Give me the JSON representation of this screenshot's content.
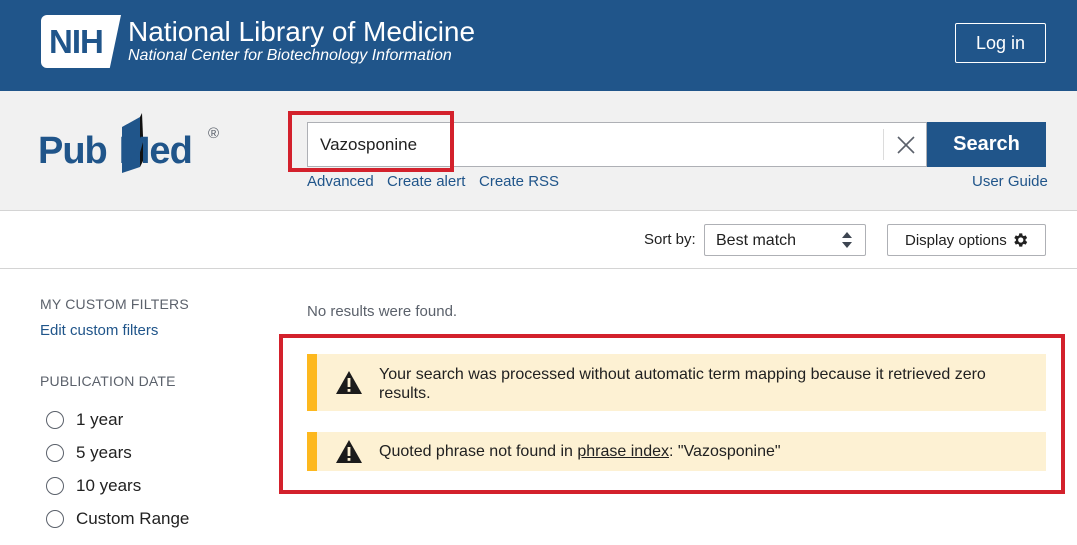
{
  "header": {
    "logo_text": "NIH",
    "title": "National Library of Medicine",
    "subtitle": "National Center for Biotechnology Information",
    "login_label": "Log in",
    "background_color": "#20558a"
  },
  "pubmed": {
    "logo_text_left": "Pub",
    "logo_text_right": "Med",
    "registered_mark": "®"
  },
  "search": {
    "query": "Vazosponine",
    "clear_icon": "close-icon",
    "button_label": "Search",
    "links": {
      "advanced": "Advanced",
      "create_alert": "Create alert",
      "create_rss": "Create RSS",
      "user_guide": "User Guide"
    }
  },
  "toolbar": {
    "sort_label": "Sort by:",
    "sort_value": "Best match",
    "display_options_label": "Display options",
    "display_icon": "gear-icon"
  },
  "sidebar": {
    "custom_filters_heading": "MY CUSTOM FILTERS",
    "edit_filters_link": "Edit custom filters",
    "pub_date_heading": "PUBLICATION DATE",
    "date_options": [
      "1 year",
      "5 years",
      "10 years",
      "Custom Range"
    ]
  },
  "results": {
    "no_results_text": "No results were found.",
    "alerts": [
      {
        "icon": "warning-icon",
        "text": "Your search was processed without automatic term mapping because it retrieved zero results."
      },
      {
        "icon": "warning-icon",
        "text_before": "Quoted phrase not found in ",
        "link_text": "phrase index",
        "text_after": ": \"Vazosponine\""
      }
    ]
  },
  "colors": {
    "brand_blue": "#20558a",
    "alert_background": "#fdf1d3",
    "alert_accent": "#fdb81e",
    "annotation_red": "#d3212c"
  }
}
